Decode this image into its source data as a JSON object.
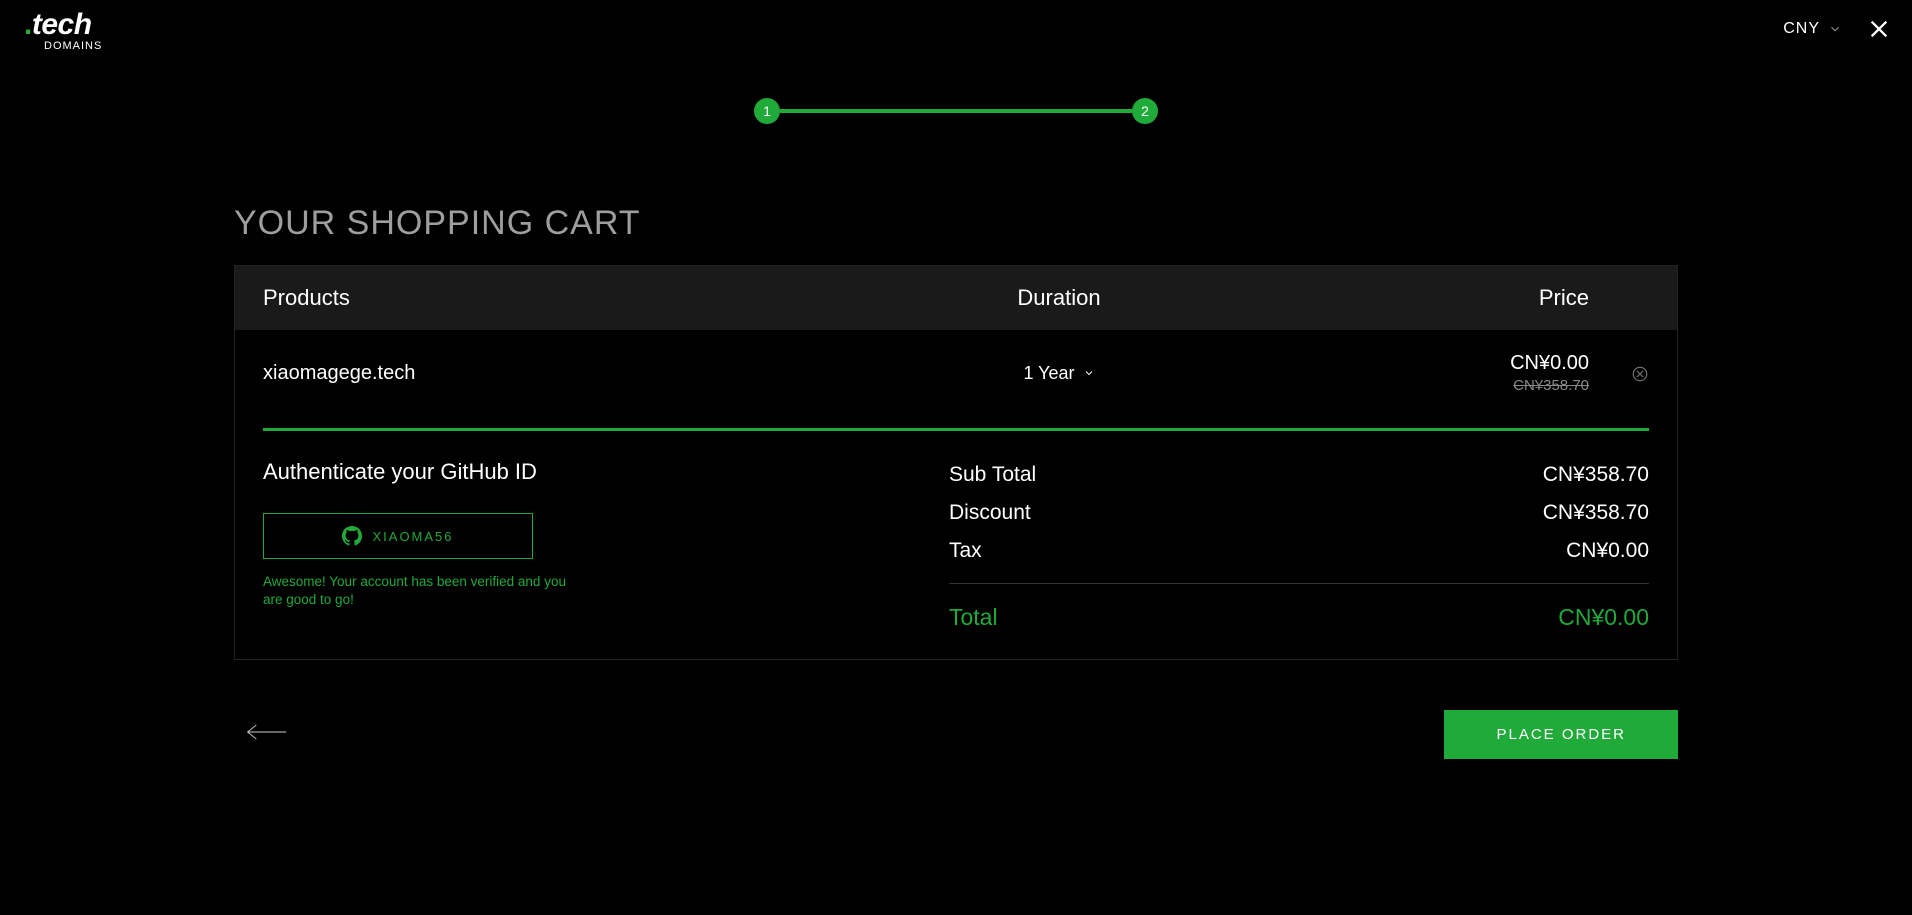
{
  "header": {
    "logo_dot": ".",
    "logo_tech": "tech",
    "logo_sub": "DOMAINS",
    "currency": "CNY"
  },
  "stepper": {
    "step1": "1",
    "step2": "2"
  },
  "title": "YOUR SHOPPING CART",
  "columns": {
    "products": "Products",
    "duration": "Duration",
    "price": "Price"
  },
  "item": {
    "domain": "xiaomagege.tech",
    "duration": "1 Year",
    "price_now": "CN¥0.00",
    "price_old": "CN¥358.70"
  },
  "auth": {
    "title": "Authenticate your GitHub ID",
    "github_user": "XIAOMA56",
    "verified_msg": "Awesome! Your account has been verified and you are good to go!"
  },
  "totals": {
    "subtotal_label": "Sub Total",
    "subtotal_value": "CN¥358.70",
    "discount_label": "Discount",
    "discount_value": "CN¥358.70",
    "tax_label": "Tax",
    "tax_value": "CN¥0.00",
    "total_label": "Total",
    "total_value": "CN¥0.00"
  },
  "buttons": {
    "place_order": "PLACE ORDER"
  }
}
